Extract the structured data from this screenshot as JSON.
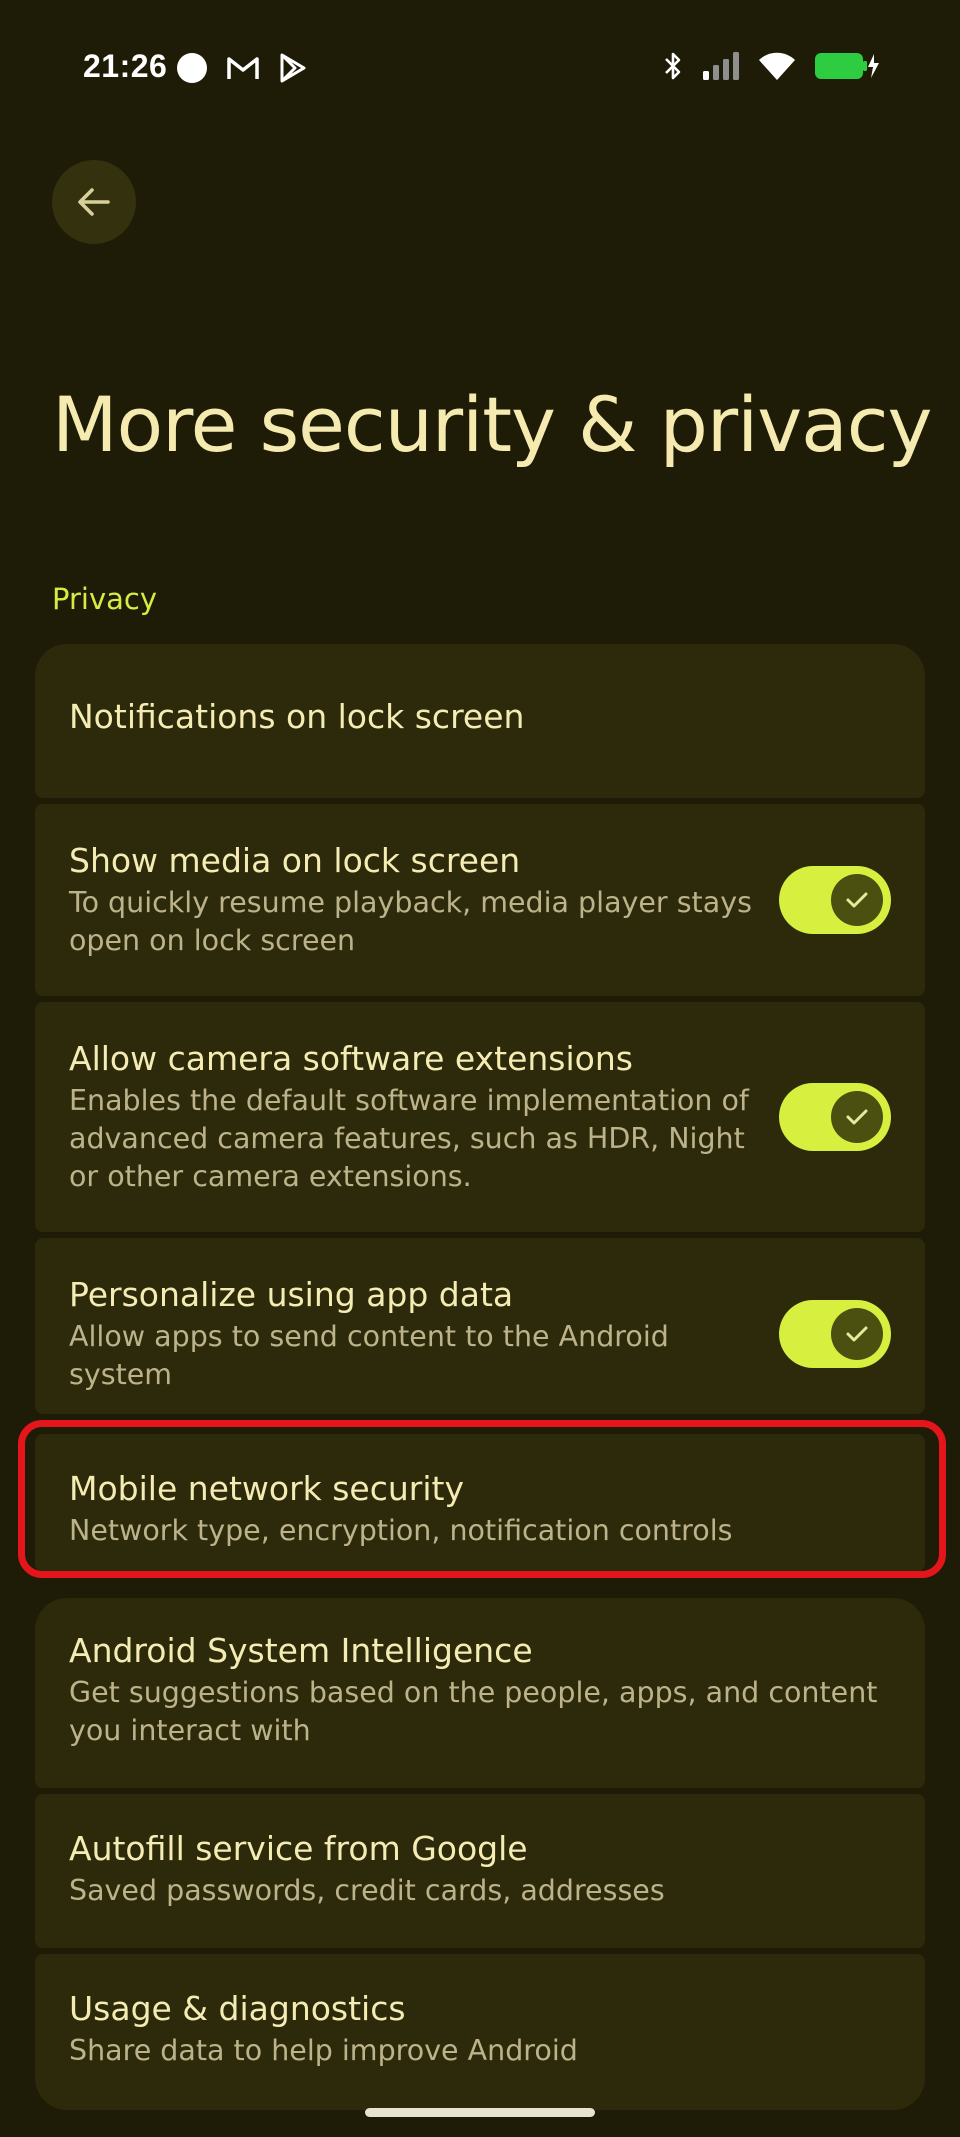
{
  "status_bar": {
    "time": "21:26",
    "left_icons": [
      "record-dot-icon",
      "gmail-icon",
      "play-store-icon"
    ],
    "right_icons": [
      "bluetooth-icon",
      "signal-icon",
      "wifi-icon",
      "battery-charging-icon"
    ],
    "battery_color": "#2ecc40"
  },
  "header": {
    "back_icon": "arrow-left-icon",
    "title": "More security & privacy"
  },
  "section": {
    "label": "Privacy"
  },
  "settings": [
    {
      "title": "Notifications on lock screen",
      "subtitle": ""
    },
    {
      "title": "Show media on lock screen",
      "subtitle": "To quickly resume playback, media player stays open on lock screen",
      "toggle": true
    },
    {
      "title": "Allow camera software extensions",
      "subtitle": "Enables the default software implementation of advanced camera features, such as HDR, Night or other camera extensions.",
      "toggle": true
    },
    {
      "title": "Personalize using app data",
      "subtitle": "Allow apps to send content to the Android system",
      "toggle": true
    },
    {
      "title": "Mobile network security",
      "subtitle": "Network type, encryption, notification controls",
      "highlighted": true
    },
    {
      "title": "Android System Intelligence",
      "subtitle": "Get suggestions based on the people, apps, and content you interact with"
    },
    {
      "title": "Autofill service from Google",
      "subtitle": "Saved passwords, credit cards, addresses"
    },
    {
      "title": "Usage & diagnostics",
      "subtitle": "Share data to help improve Android"
    }
  ],
  "colors": {
    "background": "#1e1b06",
    "card": "#2c2a0b",
    "accent": "#d7ef3f",
    "highlight": "#e4151b"
  }
}
